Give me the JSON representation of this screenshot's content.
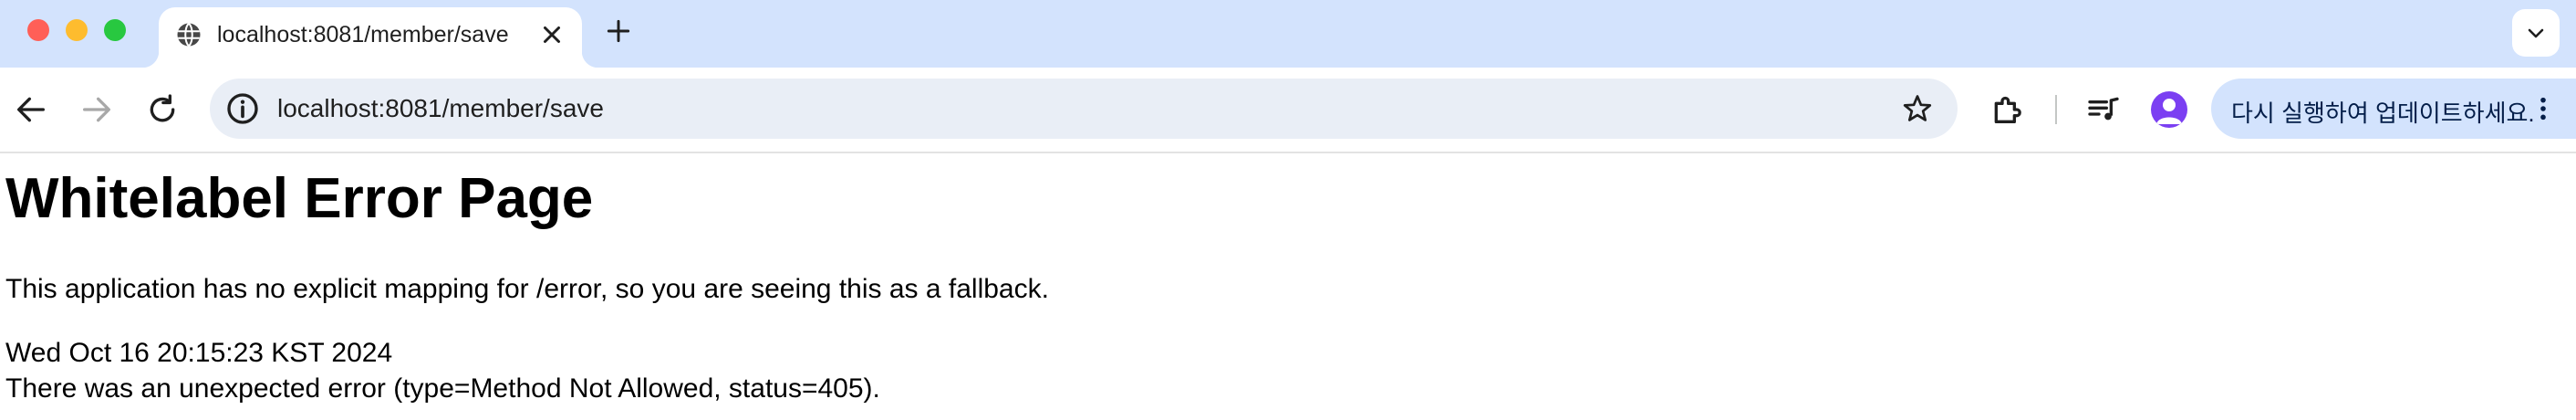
{
  "tab": {
    "title": "localhost:8081/member/save",
    "favicon": "globe-icon"
  },
  "omnibox": {
    "url": "localhost:8081/member/save"
  },
  "toolbar": {
    "update_label": "다시 실행하여 업데이트하세요."
  },
  "colors": {
    "tabstrip_bg": "#d3e3fd",
    "omnibox_bg": "#e9eef6",
    "avatar": "#7b3ff2"
  },
  "page": {
    "heading": "Whitelabel Error Page",
    "message": "This application has no explicit mapping for /error, so you are seeing this as a fallback.",
    "timestamp": "Wed Oct 16 20:15:23 KST 2024",
    "error": "There was an unexpected error (type=Method Not Allowed, status=405)."
  }
}
